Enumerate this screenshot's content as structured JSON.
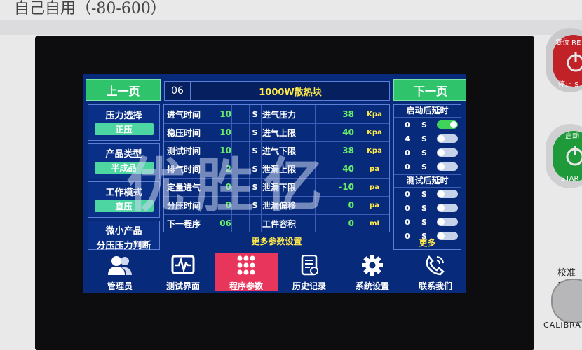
{
  "header_label": "自己自用（-80-600）",
  "nav": {
    "prev": "上一页",
    "next": "下一页"
  },
  "program": {
    "number": "06",
    "name": "1000W散热块"
  },
  "left": [
    {
      "title": "压力选择",
      "value": "正压"
    },
    {
      "title": "产品类型",
      "value": "半成品"
    },
    {
      "title": "工作模式",
      "value": "直压"
    },
    {
      "title": "微小产品",
      "subtitle": "分压压力判断"
    }
  ],
  "params": [
    {
      "l1": "进气时间",
      "v1": "10",
      "u1": "S",
      "l2": "进气压力",
      "v2": "38",
      "u2": "Kpa"
    },
    {
      "l1": "稳压时间",
      "v1": "10",
      "u1": "S",
      "l2": "进气上限",
      "v2": "40",
      "u2": "Kpa"
    },
    {
      "l1": "测试时间",
      "v1": "10",
      "u1": "S",
      "l2": "进气下限",
      "v2": "38",
      "u2": "Kpa"
    },
    {
      "l1": "排气时间",
      "v1": "2",
      "u1": "S",
      "l2": "泄漏上限",
      "v2": "40",
      "u2": "pa"
    },
    {
      "l1": "定量进气",
      "v1": "0",
      "u1": "S",
      "l2": "泄漏下限",
      "v2": "-10",
      "u2": "pa"
    },
    {
      "l1": "分压时间",
      "v1": "0",
      "u1": "S",
      "l2": "泄漏偏移",
      "v2": "0",
      "u2": "pa"
    },
    {
      "l1": "下一程序",
      "v1": "06",
      "u1": "",
      "l2": "工件容积",
      "v2": "0",
      "u2": "ml"
    }
  ],
  "more_params": "更多参数设置",
  "start_delay": {
    "title": "启动后延时",
    "rows": [
      {
        "num": "0",
        "unit": "S",
        "on": true
      },
      {
        "num": "4",
        "unit": "S",
        "on": false
      },
      {
        "num": "0",
        "unit": "S",
        "on": false
      },
      {
        "num": "0",
        "unit": "S",
        "on": false
      }
    ]
  },
  "test_delay": {
    "title": "测试后延时",
    "rows": [
      {
        "num": "0",
        "unit": "S",
        "on": false
      },
      {
        "num": "0",
        "unit": "S",
        "on": false
      },
      {
        "num": "0",
        "unit": "S",
        "on": false
      },
      {
        "num": "0",
        "unit": "S",
        "on": false
      }
    ]
  },
  "right_more": "更多",
  "bottom_nav": [
    {
      "label": "管理员",
      "icon": "users-icon",
      "active": false
    },
    {
      "label": "测试界面",
      "icon": "waveform-monitor-icon",
      "active": false
    },
    {
      "label": "程序参数",
      "icon": "keypad-grid-icon",
      "active": true
    },
    {
      "label": "历史记录",
      "icon": "document-history-icon",
      "active": false
    },
    {
      "label": "系统设置",
      "icon": "gear-icon",
      "active": false
    },
    {
      "label": "联系我们",
      "icon": "phone-icon",
      "active": false
    }
  ],
  "watermark": "优胜亿",
  "hardware": {
    "reset_top": "复位 RE",
    "reset_bottom": "停止 S",
    "start_top": "启动",
    "start_bottom": "STAR",
    "calib_label": "校准口",
    "calib_text": "CALIBRA"
  },
  "colors": {
    "screen_bg": "#082a7a",
    "accent_green": "#2fc46c",
    "value_green": "#66f06a",
    "highlight_yellow": "#ffe94a",
    "active_tab": "#e8355c"
  }
}
